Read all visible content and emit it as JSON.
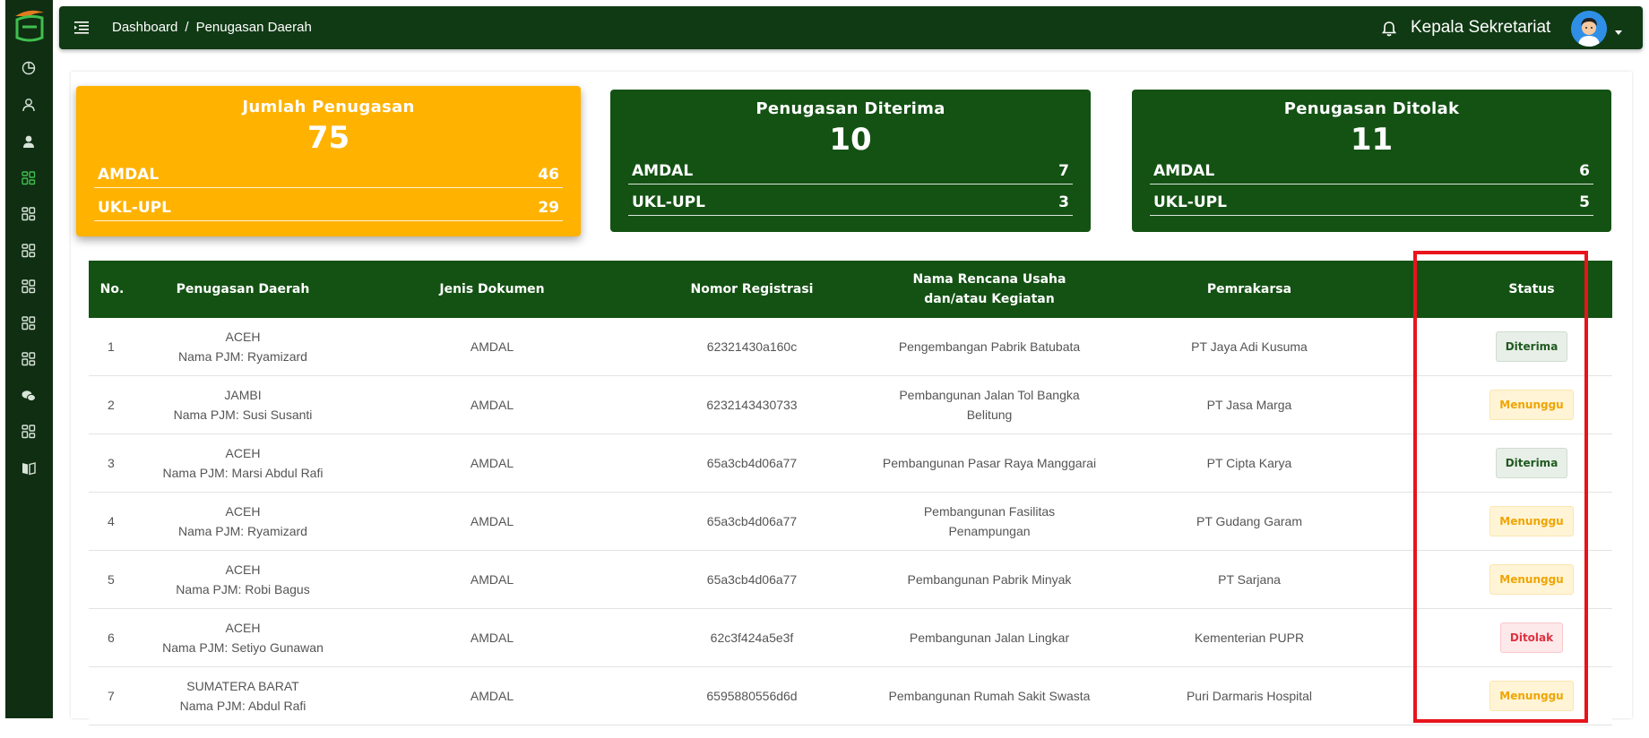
{
  "topbar": {
    "breadcrumb": [
      "Dashboard",
      "Penugasan Daerah"
    ],
    "breadcrumb_sep": "/",
    "user_name": "Kepala Sekretariat"
  },
  "colors": {
    "sidebar": "#0f2e12",
    "topbar": "#103a14",
    "card_yellow": "#ffb200",
    "card_green": "#145214",
    "highlight": "#e8141c"
  },
  "sidebar_icons": [
    "dashboard-pie-icon",
    "user-outline-icon",
    "user-solid-icon",
    "grid-icon-active",
    "grid-icon",
    "grid-icon",
    "grid-icon",
    "grid-icon",
    "grid-icon",
    "chat-icon",
    "grid-icon",
    "book-icon"
  ],
  "cards": [
    {
      "title": "Jumlah Penugasan",
      "total": "75",
      "rows": [
        {
          "label": "AMDAL",
          "value": "46"
        },
        {
          "label": "UKL-UPL",
          "value": "29"
        }
      ]
    },
    {
      "title": "Penugasan Diterima",
      "total": "10",
      "rows": [
        {
          "label": "AMDAL",
          "value": "7"
        },
        {
          "label": "UKL-UPL",
          "value": "3"
        }
      ]
    },
    {
      "title": "Penugasan Ditolak",
      "total": "11",
      "rows": [
        {
          "label": "AMDAL",
          "value": "6"
        },
        {
          "label": "UKL-UPL",
          "value": "5"
        }
      ]
    }
  ],
  "table": {
    "headers": [
      "No.",
      "Penugasan Daerah",
      "Jenis Dokumen",
      "Nomor Registrasi",
      "Nama Rencana Usaha dan/atau Kegiatan",
      "Pemrakarsa",
      "Status"
    ],
    "rows": [
      {
        "no": "1",
        "daerah": "ACEH",
        "pjm": "Nama PJM: Ryamizard",
        "jenis": "AMDAL",
        "nomor": "62321430a160c",
        "nama": "Pengembangan Pabrik Batubata",
        "pemrakarsa": "PT Jaya Adi Kusuma",
        "status": "Diterima"
      },
      {
        "no": "2",
        "daerah": "JAMBI",
        "pjm": "Nama PJM: Susi Susanti",
        "jenis": "AMDAL",
        "nomor": "6232143430733",
        "nama": "Pembangunan Jalan Tol Bangka Belitung",
        "pemrakarsa": "PT Jasa Marga",
        "status": "Menunggu"
      },
      {
        "no": "3",
        "daerah": "ACEH",
        "pjm": "Nama PJM: Marsi Abdul Rafi",
        "jenis": "AMDAL",
        "nomor": "65a3cb4d06a77",
        "nama": "Pembangunan Pasar Raya Manggarai",
        "pemrakarsa": "PT Cipta Karya",
        "status": "Diterima"
      },
      {
        "no": "4",
        "daerah": "ACEH",
        "pjm": "Nama PJM: Ryamizard",
        "jenis": "AMDAL",
        "nomor": "65a3cb4d06a77",
        "nama": "Pembangunan Fasilitas Penampungan",
        "pemrakarsa": "PT Gudang Garam",
        "status": "Menunggu"
      },
      {
        "no": "5",
        "daerah": "ACEH",
        "pjm": "Nama PJM: Robi Bagus",
        "jenis": "AMDAL",
        "nomor": "65a3cb4d06a77",
        "nama": "Pembangunan Pabrik Minyak",
        "pemrakarsa": "PT Sarjana",
        "status": "Menunggu"
      },
      {
        "no": "6",
        "daerah": "ACEH",
        "pjm": "Nama PJM: Setiyo Gunawan",
        "jenis": "AMDAL",
        "nomor": "62c3f424a5e3f",
        "nama": "Pembangunan Jalan Lingkar",
        "pemrakarsa": "Kementerian PUPR",
        "status": "Ditolak"
      },
      {
        "no": "7",
        "daerah": "SUMATERA BARAT",
        "pjm": "Nama PJM: Abdul Rafi",
        "jenis": "AMDAL",
        "nomor": "6595880556d6d",
        "nama": "Pembangunan Rumah Sakit Swasta",
        "pemrakarsa": "Puri Darmaris Hospital",
        "status": "Menunggu"
      }
    ]
  }
}
